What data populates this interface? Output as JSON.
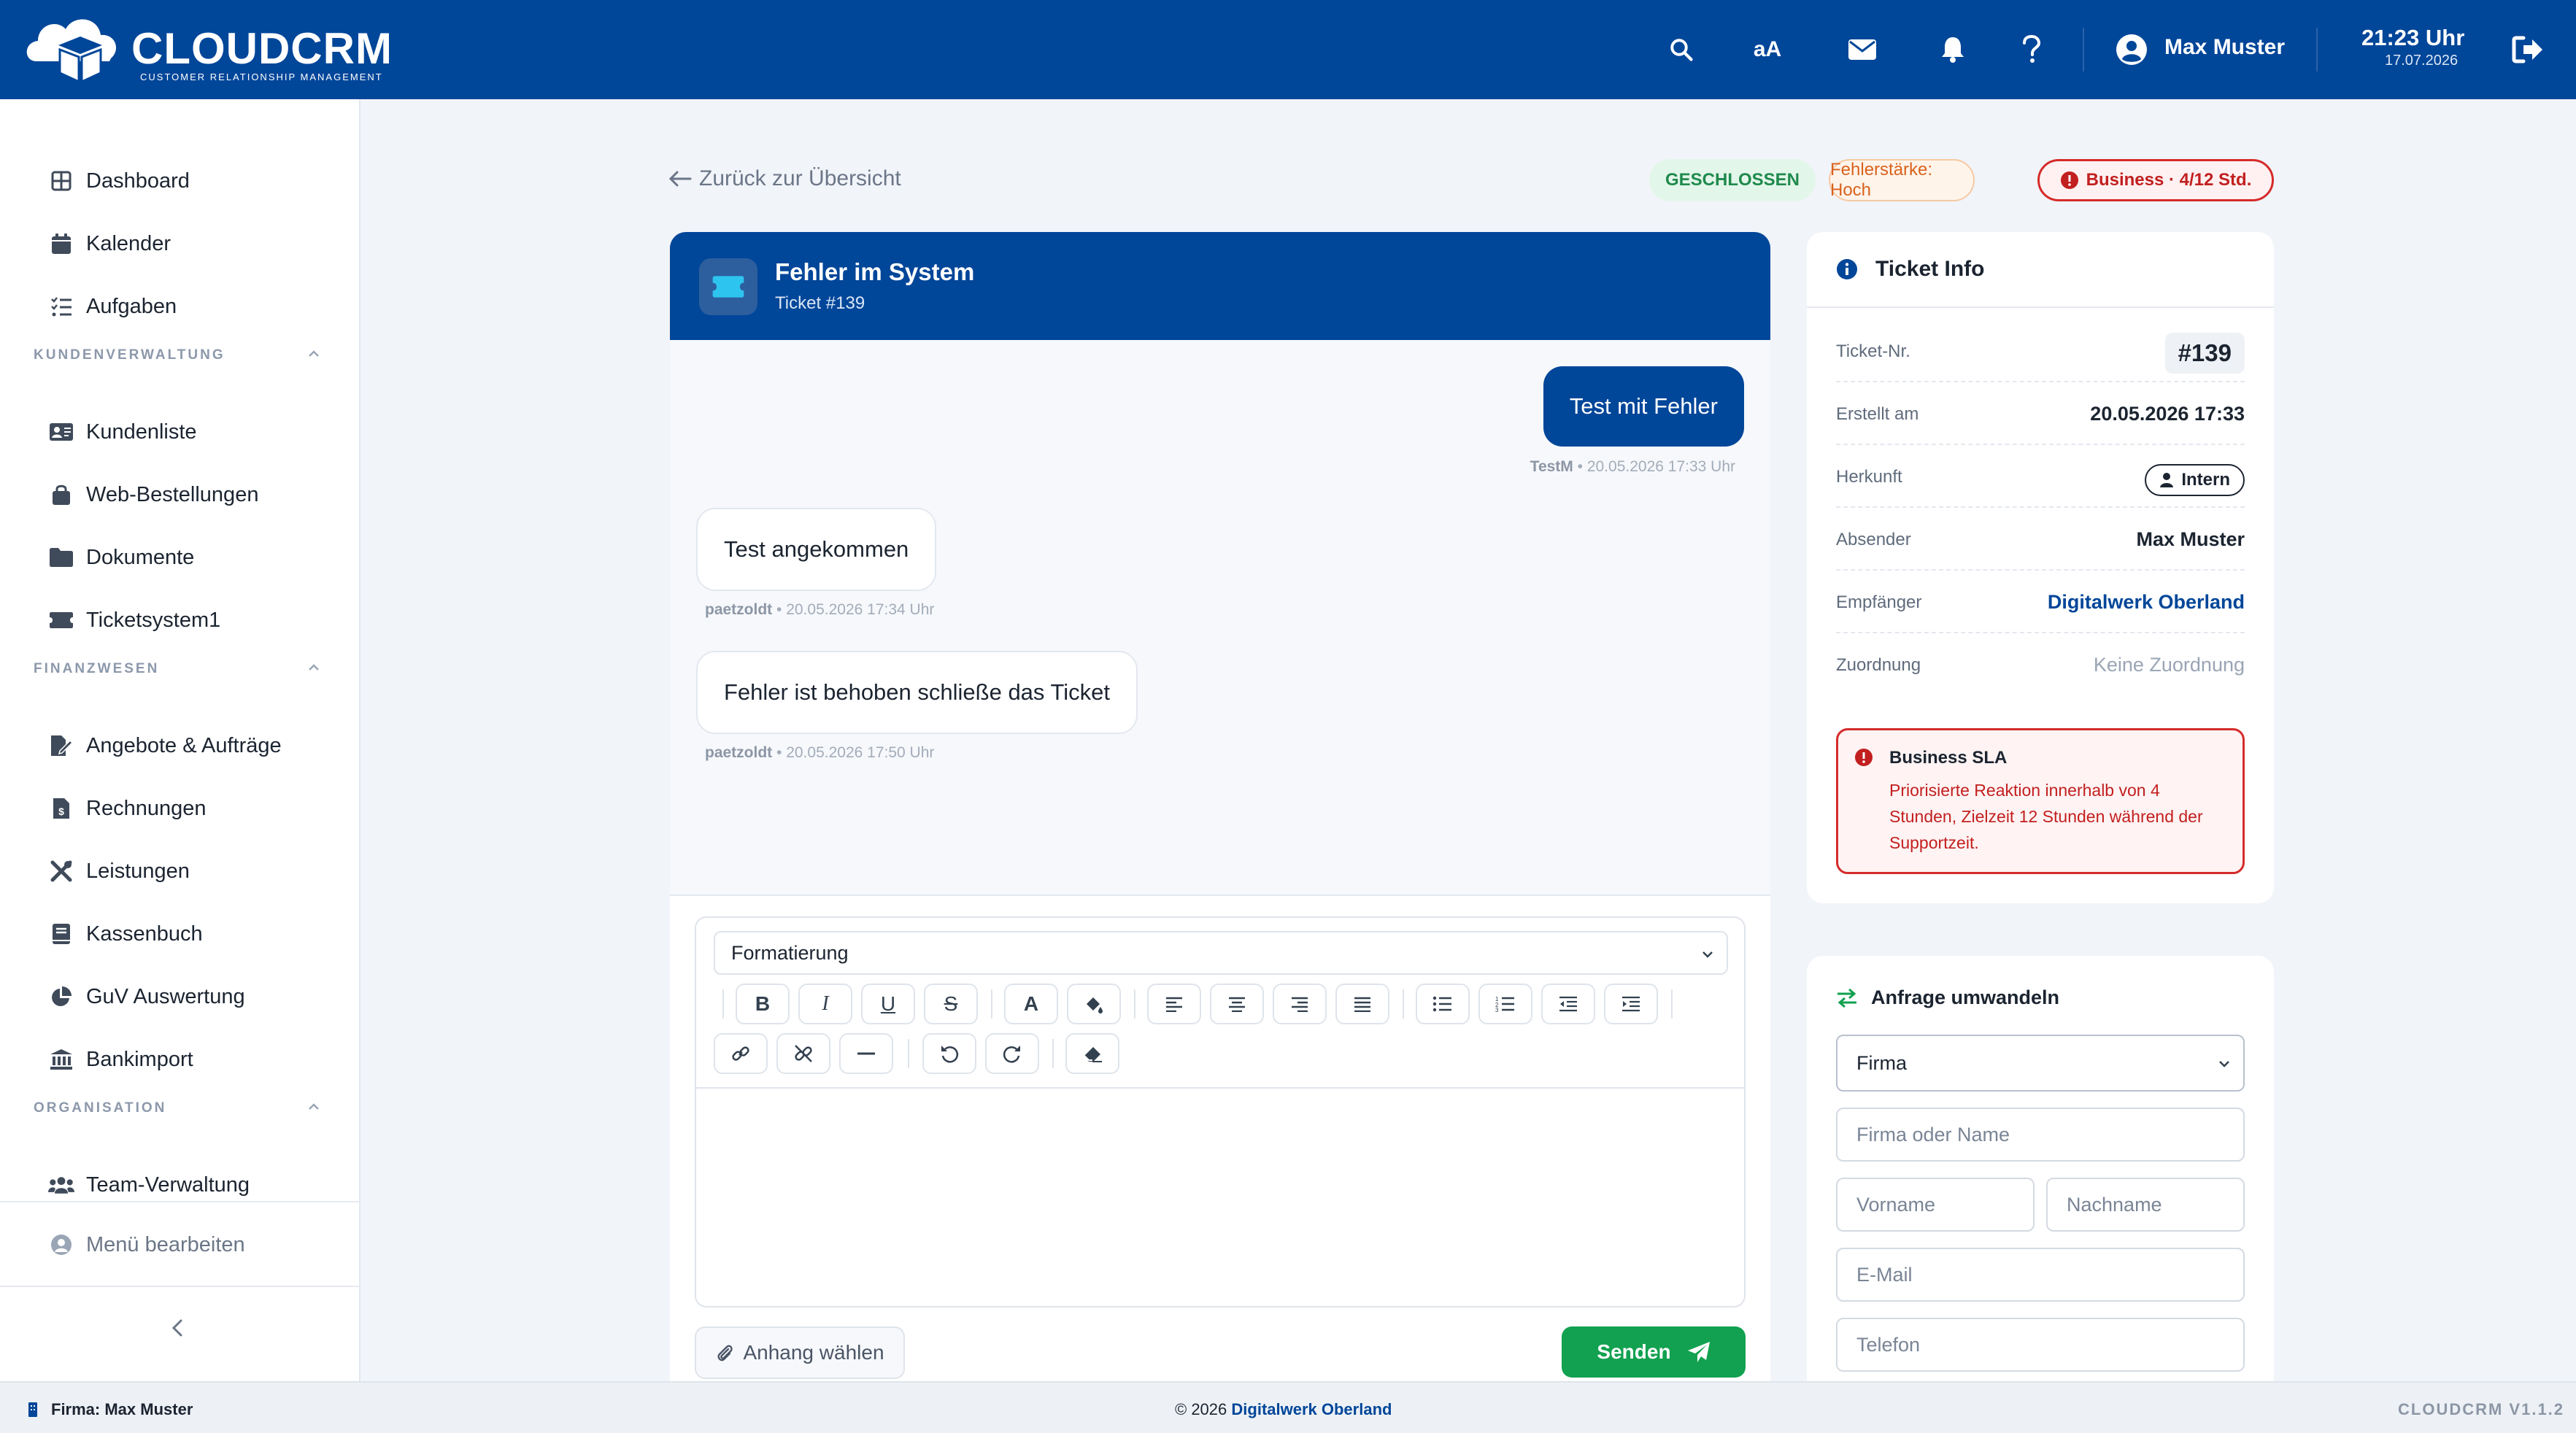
{
  "app": {
    "brand": "CLOUDCRM",
    "tagline": "CUSTOMER RELATIONSHIP MANAGEMENT"
  },
  "topbar": {
    "font_toggle": "aA",
    "user_name": "Max Muster",
    "time": "21:23 Uhr",
    "date": "17.07.2026",
    "icons": [
      "search-icon",
      "font-size-icon",
      "mail-icon",
      "bell-icon",
      "help-icon",
      "user-icon",
      "logout-icon"
    ]
  },
  "sidebar": {
    "items": [
      {
        "label": "Dashboard",
        "icon": "dashboard-icon"
      },
      {
        "label": "Kalender",
        "icon": "calendar-icon"
      },
      {
        "label": "Aufgaben",
        "icon": "tasks-icon"
      }
    ],
    "sections": [
      {
        "title": "KUNDENVERWALTUNG",
        "items": [
          {
            "label": "Kundenliste",
            "icon": "address-card-icon"
          },
          {
            "label": "Web-Bestellungen",
            "icon": "shopping-bag-icon"
          },
          {
            "label": "Dokumente",
            "icon": "folder-icon"
          },
          {
            "label": "Ticketsystem1",
            "icon": "ticket-icon"
          }
        ]
      },
      {
        "title": "FINANZWESEN",
        "items": [
          {
            "label": "Angebote & Aufträge",
            "icon": "file-signature-icon"
          },
          {
            "label": "Rechnungen",
            "icon": "invoice-icon"
          },
          {
            "label": "Leistungen",
            "icon": "tools-icon"
          },
          {
            "label": "Kassenbuch",
            "icon": "book-icon"
          },
          {
            "label": "GuV Auswertung",
            "icon": "pie-chart-icon"
          },
          {
            "label": "Bankimport",
            "icon": "bank-icon"
          }
        ]
      },
      {
        "title": "ORGANISATION",
        "items": [
          {
            "label": "Team-Verwaltung",
            "icon": "users-icon"
          }
        ]
      }
    ],
    "menu_edit": "Menü bearbeiten"
  },
  "header": {
    "back_label": "Zurück zur Übersicht",
    "status_badge": "GESCHLOSSEN",
    "severity_badge": "Fehlerstärke: Hoch",
    "sla_badge": "Business · 4/12 Std."
  },
  "ticket": {
    "title": "Fehler im System",
    "subtitle": "Ticket #139",
    "messages": [
      {
        "text": "Test mit Fehler",
        "author": "TestM",
        "time": "• 20.05.2026 17:33 Uhr",
        "direction": "out"
      },
      {
        "text": "Test angekommen",
        "author": "paetzoldt",
        "time": "• 20.05.2026 17:34 Uhr",
        "direction": "in"
      },
      {
        "text": "Fehler ist behoben schließe das Ticket",
        "author": "paetzoldt",
        "time": "• 20.05.2026 17:50 Uhr",
        "direction": "in"
      }
    ]
  },
  "editor": {
    "format_select": "Formatierung",
    "toolbar": {
      "bold": "B",
      "italic": "I",
      "underline": "U",
      "strike": "S",
      "font_color": "A"
    },
    "attach_label": "Anhang wählen",
    "send_label": "Senden"
  },
  "info": {
    "title": "Ticket Info",
    "rows": {
      "ticket_no": {
        "label": "Ticket-Nr.",
        "value": "#139"
      },
      "created": {
        "label": "Erstellt am",
        "value": "20.05.2026 17:33"
      },
      "origin": {
        "label": "Herkunft",
        "value": "Intern"
      },
      "sender": {
        "label": "Absender",
        "value": "Max Muster"
      },
      "recipient": {
        "label": "Empfänger",
        "value": "Digitalwerk Oberland"
      },
      "assignment": {
        "label": "Zuordnung",
        "value": "Keine Zuordnung"
      }
    },
    "sla": {
      "title": "Business SLA",
      "text": "Priorisierte Reaktion innerhalb von 4 Stunden, Zielzeit 12 Stunden während der Supportzeit."
    }
  },
  "convert": {
    "title": "Anfrage umwandeln",
    "type_select": "Firma",
    "placeholders": {
      "company": "Firma oder Name",
      "firstname": "Vorname",
      "lastname": "Nachname",
      "email": "E-Mail",
      "phone": "Telefon"
    }
  },
  "footer": {
    "company": "Firma: Max Muster",
    "copyright": "© 2026",
    "copyright_company": "Digitalwerk Oberland",
    "version": "CLOUDCRM V1.1.2"
  },
  "colors": {
    "primary": "#004699",
    "success": "#12a150",
    "danger": "#d52b2b",
    "warning": "#d9621c",
    "background": "#f1f4f9"
  }
}
